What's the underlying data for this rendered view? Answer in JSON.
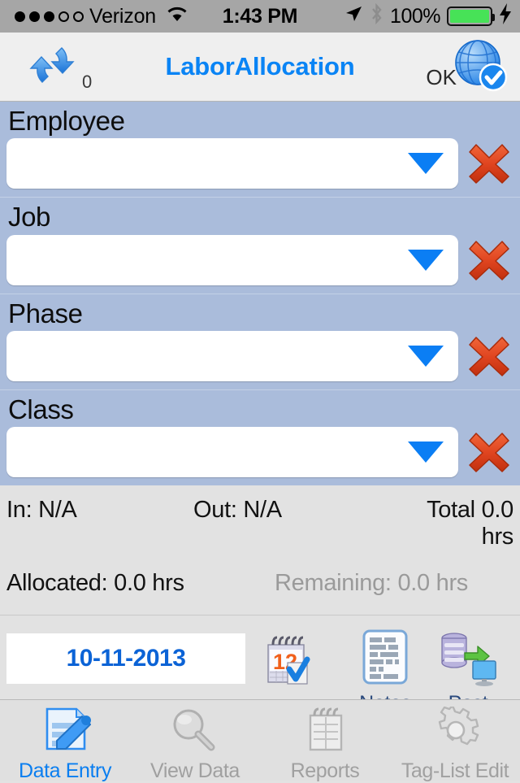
{
  "status_bar": {
    "carrier": "Verizon",
    "signal_filled": 3,
    "signal_total": 5,
    "wifi_icon": "wifi-icon",
    "time": "1:43 PM",
    "location_icon": "location-arrow-icon",
    "bluetooth_icon": "bluetooth-icon",
    "battery_percent": "100%",
    "battery_color": "#47e257",
    "charging_icon": "lightning-bolt-icon"
  },
  "nav_bar": {
    "title": "LaborAllocation",
    "title_color": "#0a84f5",
    "sync_icon": "sync-refresh-icon",
    "sync_count": "0",
    "connection_label": "OK",
    "globe_icon": "globe-check-icon"
  },
  "form": {
    "background_color": "#aabcdb",
    "fields": [
      {
        "label": "Employee",
        "value": "",
        "caret_icon": "chevron-down-icon",
        "clear_icon": "red-x-clear-icon"
      },
      {
        "label": "Job",
        "value": "",
        "caret_icon": "chevron-down-icon",
        "clear_icon": "red-x-clear-icon"
      },
      {
        "label": "Phase",
        "value": "",
        "caret_icon": "chevron-down-icon",
        "clear_icon": "red-x-clear-icon"
      },
      {
        "label": "Class",
        "value": "",
        "caret_icon": "chevron-down-icon",
        "clear_icon": "red-x-clear-icon"
      }
    ]
  },
  "status_lines": {
    "in": "In: N/A",
    "out": "Out: N/A",
    "total": "Total 0.0 hrs",
    "allocated": "Allocated: 0.0 hrs",
    "remaining": "Remaining: 0.0 hrs",
    "remaining_color": "#9a9a9a"
  },
  "actions": {
    "date_value": "10-11-2013",
    "date_color": "#0b63d6",
    "calendar_icon": "calendar-picker-icon",
    "notes_icon": "notes-document-icon",
    "notes_label": "Notes",
    "post_icon": "post-database-to-monitor-icon",
    "post_label": "Post"
  },
  "tab_bar": {
    "active_color": "#0a7ef0",
    "inactive_color": "#a0a0a0",
    "tabs": [
      {
        "label": "Data Entry",
        "icon": "data-entry-pencil-icon",
        "active": true
      },
      {
        "label": "View Data",
        "icon": "magnifier-icon",
        "active": false
      },
      {
        "label": "Reports",
        "icon": "notepad-icon",
        "active": false
      },
      {
        "label": "Tag-List Edit",
        "icon": "gear-icon",
        "active": false
      }
    ]
  }
}
